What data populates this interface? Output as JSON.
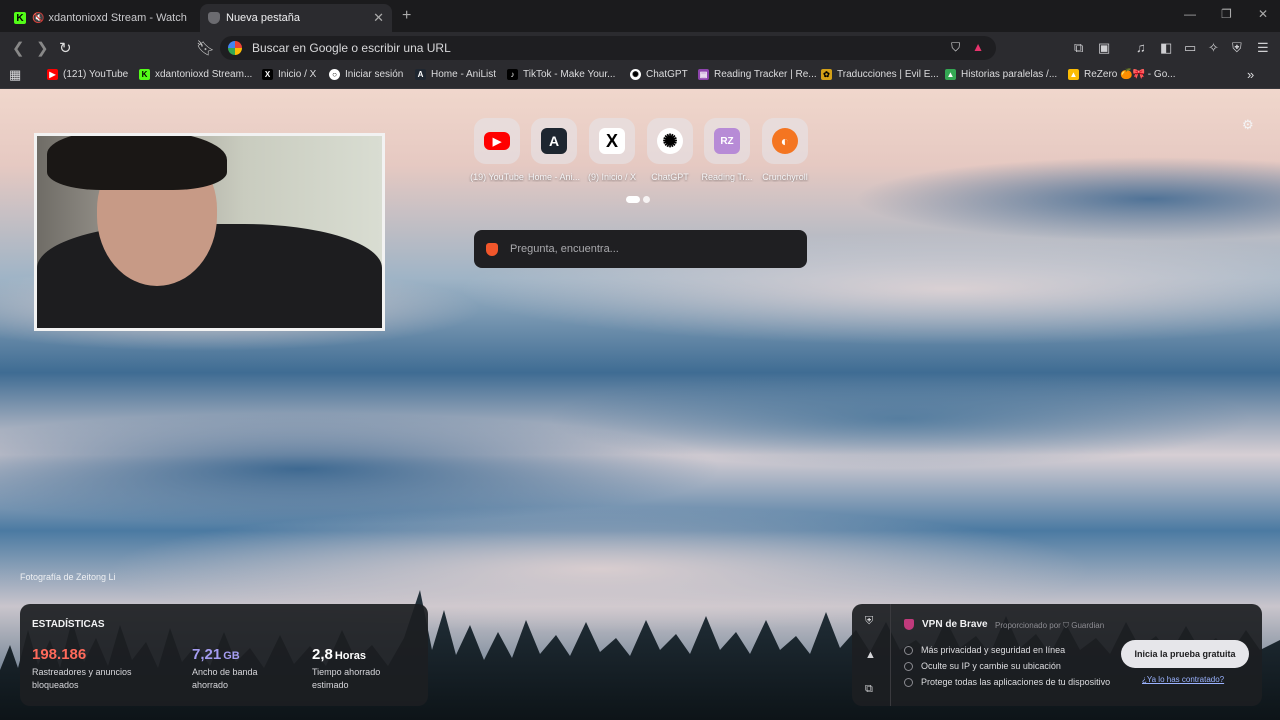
{
  "tabs": [
    {
      "title": "xdantonioxd Stream - Watch Live",
      "favicon": "kick-icon",
      "active": false
    },
    {
      "title": "Nueva pestaña",
      "favicon": "brave-shield-icon",
      "active": true
    }
  ],
  "omnibox": {
    "text": "Buscar en Google o escribir una URL"
  },
  "bookmarks": [
    {
      "label": "(121) YouTube",
      "color": "#ff0000"
    },
    {
      "label": "xdantonioxd Stream...",
      "color": "#53fc18"
    },
    {
      "label": "Inicio / X",
      "color": "#000000"
    },
    {
      "label": "Iniciar sesión",
      "color": "#ffffff"
    },
    {
      "label": "Home - AniList",
      "color": "#1e2630"
    },
    {
      "label": "TikTok - Make Your...",
      "color": "#000000"
    },
    {
      "label": "ChatGPT",
      "color": "#ffffff"
    },
    {
      "label": "Reading Tracker | Re...",
      "color": "#8e44ad"
    },
    {
      "label": "Traducciones | Evil E...",
      "color": "#d4a017"
    },
    {
      "label": "Historias paralelas /...",
      "color": "#34a853"
    },
    {
      "label": "ReZero 🍊🎀 - Go...",
      "color": "#fbbc05"
    }
  ],
  "speed_dial": [
    {
      "label": "(19) YouTube",
      "icon": "youtube-icon"
    },
    {
      "label": "Home - Ani...",
      "icon": "anilist-icon"
    },
    {
      "label": "(9) Inicio / X",
      "icon": "x-icon"
    },
    {
      "label": "ChatGPT",
      "icon": "chatgpt-icon"
    },
    {
      "label": "Reading Tr...",
      "icon": "reading-tracker-icon"
    },
    {
      "label": "Crunchyroll",
      "icon": "crunchyroll-icon"
    }
  ],
  "search": {
    "placeholder": "Pregunta, encuentra..."
  },
  "photo_credit": "Fotografía de Zeitong Li",
  "stats": {
    "header": "ESTADÍSTICAS",
    "trackers": {
      "value": "198.186",
      "desc": "Rastreadores y anuncios bloqueados",
      "color": "#ff6a5b"
    },
    "bandwidth": {
      "value": "7,21",
      "unit": "GB",
      "desc": "Ancho de banda ahorrado",
      "color": "#a49cf0"
    },
    "time": {
      "value": "2,8",
      "unit": "Horas",
      "desc": "Tiempo ahorrado estimado",
      "color": "#ffffff"
    }
  },
  "vpn": {
    "title": "VPN de Brave",
    "powered": "Proporcionado por ⛉ Guardian",
    "features": [
      "Más privacidad y seguridad en línea",
      "Oculte su IP y cambie su ubicación",
      "Protege todas las aplicaciones de tu dispositivo"
    ],
    "cta": "Inicia la prueba gratuita",
    "already": "¿Ya lo has contratado?"
  }
}
